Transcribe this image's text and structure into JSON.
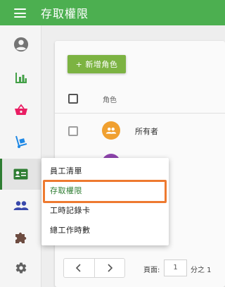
{
  "appbar": {
    "title": "存取權限",
    "menu_icon": "hamburger-icon",
    "color": "#4caf50"
  },
  "sidebar": {
    "items": [
      {
        "name": "profile",
        "icon": "account-circle-icon",
        "color": "#666666"
      },
      {
        "name": "reports",
        "icon": "bar-chart-icon",
        "color": "#43a047"
      },
      {
        "name": "sales",
        "icon": "basket-icon",
        "color": "#e91e63"
      },
      {
        "name": "delivery",
        "icon": "hand-truck-icon",
        "color": "#1e88e5"
      },
      {
        "name": "employees",
        "icon": "badge-icon",
        "color": "#2e7d32",
        "active": true
      },
      {
        "name": "customers",
        "icon": "people-icon",
        "color": "#3949ab"
      },
      {
        "name": "integrations",
        "icon": "puzzle-icon",
        "color": "#6d4c41"
      },
      {
        "name": "settings",
        "icon": "gear-icon",
        "color": "#616161"
      }
    ]
  },
  "main": {
    "add_role_label": "+ 新增角色",
    "column_header": "角色",
    "rows": [
      {
        "role": "所有者",
        "avatar_color": "#f0a030"
      },
      {
        "role": "",
        "avatar_color": "#8e44ad"
      }
    ],
    "pagination": {
      "page_label": "頁面:",
      "page_value": "1",
      "page_of": "分之 1"
    }
  },
  "popup": {
    "items": [
      {
        "label": "員工清單"
      },
      {
        "label": "存取權限",
        "active": true
      },
      {
        "label": "工時記錄卡"
      },
      {
        "label": "總工作時數"
      }
    ],
    "highlight_color": "#ee7a30"
  }
}
